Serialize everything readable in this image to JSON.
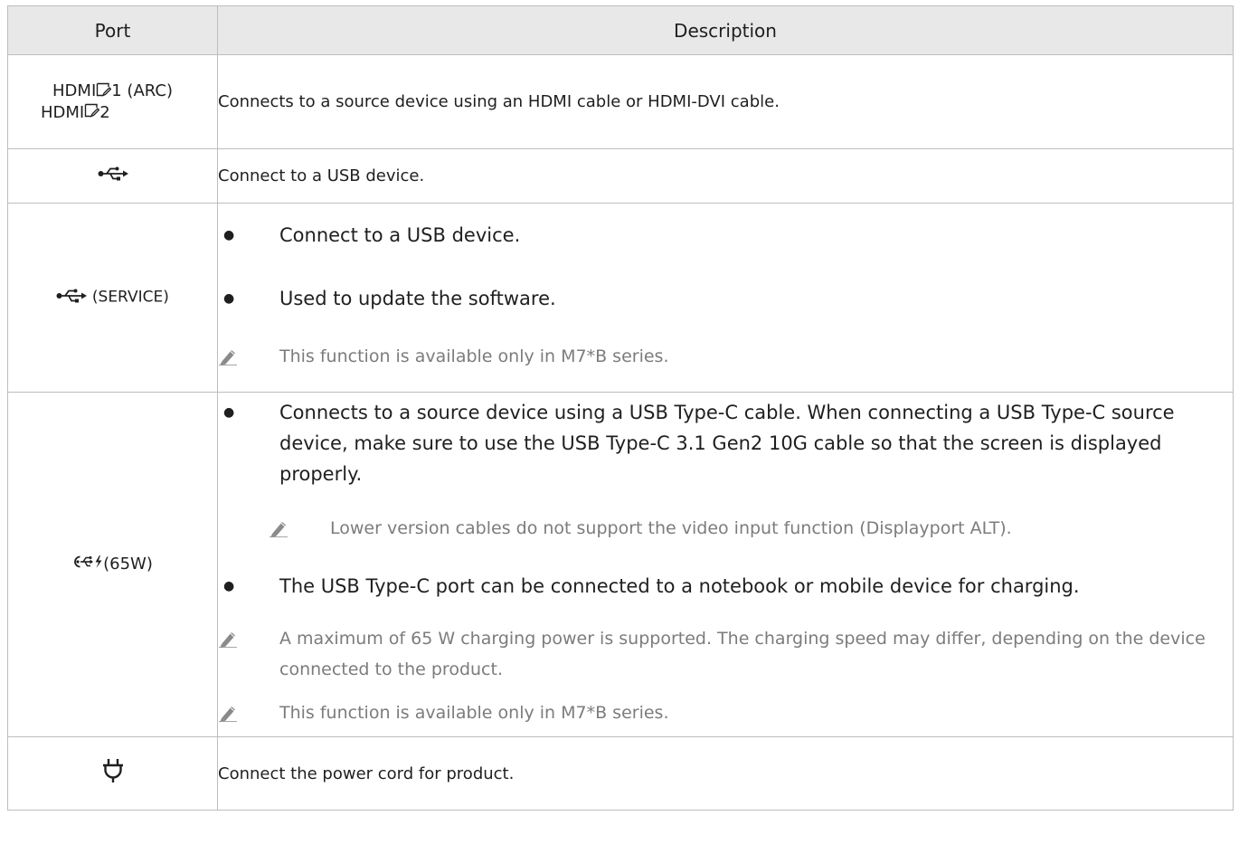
{
  "table": {
    "headers": {
      "port": "Port",
      "description": "Description"
    },
    "rows": {
      "hdmi": {
        "port_line1": "HDMI",
        "port_line1_suffix": "1 (ARC)",
        "port_line2": "HDMI",
        "port_line2_suffix": "2",
        "description": "Connects to a source device using an HDMI cable or HDMI-DVI cable."
      },
      "usb": {
        "port_icon": "usb-icon",
        "description": "Connect to a USB device."
      },
      "usb_service": {
        "port_icon": "usb-icon",
        "port_label": "(SERVICE)",
        "bullets": [
          "Connect to a USB device.",
          "Used to update the software."
        ],
        "note": "This function is available only in M7*B series."
      },
      "usbc": {
        "port_icon": "usb-c-charging-icon",
        "port_label": "(65W)",
        "bullet1": "Connects to a source device using a USB Type-C cable. When connecting a USB Type-C source device, make sure to use the USB Type-C 3.1 Gen2 10G cable so that the screen is displayed properly.",
        "sub_note": "Lower version cables do not support the video input function (Displayport ALT).",
        "bullet2": "The USB Type-C port can be connected to a notebook or mobile device for charging.",
        "note1": "A maximum of 65 W charging power is supported. The charging speed may differ, depending on the device connected to the product.",
        "note2": "This function is available only in M7*B series."
      },
      "power": {
        "port_icon": "power-plug-icon",
        "description": "Connect the power cord for product."
      }
    }
  },
  "colors": {
    "header_bg": "#e8e8e8",
    "border": "#bdbdbd",
    "text": "#1f1f1f",
    "note_text": "#7c7c7c"
  }
}
